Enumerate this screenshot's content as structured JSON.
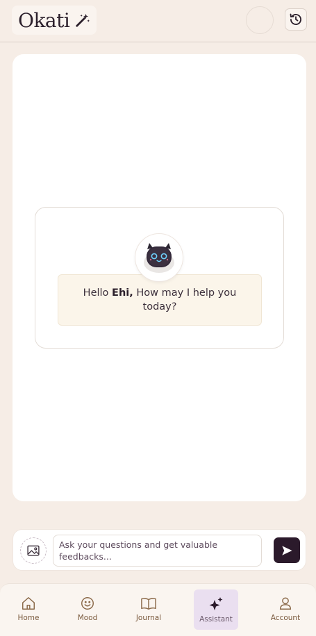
{
  "header": {
    "logo_text": "Okati",
    "icons": {
      "logo": "magic-wand-icon",
      "history": "history-icon"
    }
  },
  "chat": {
    "greeting_prefix": "Hello ",
    "user_name": "Ehi,",
    "greeting_suffix": " How may I help you today?",
    "bot_avatar": "cat-robot-avatar"
  },
  "composer": {
    "placeholder": "Ask your questions and get valuable feedbacks...",
    "icons": {
      "attach": "image-icon",
      "send": "send-icon"
    }
  },
  "nav": {
    "items": [
      {
        "label": "Home",
        "icon": "home-icon"
      },
      {
        "label": "Mood",
        "icon": "smiley-icon"
      },
      {
        "label": "Journal",
        "icon": "book-icon"
      },
      {
        "label": "Assistant",
        "icon": "sparkles-icon",
        "active": true
      },
      {
        "label": "Account",
        "icon": "user-icon"
      }
    ]
  },
  "colors": {
    "background": "#f6ede6",
    "card": "#ffffff",
    "accent_dark": "#2b1a2b",
    "bubble": "#fbf5ea",
    "nav_label": "#7a5a3e",
    "active_tab": "#eadff0"
  }
}
